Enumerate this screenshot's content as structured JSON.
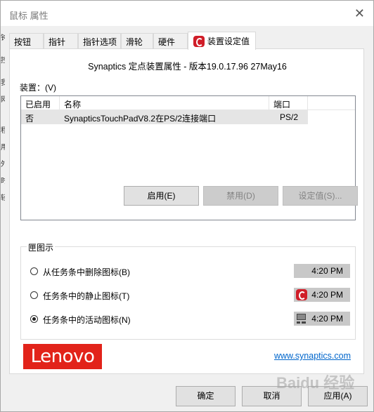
{
  "window": {
    "title": "鼠标 属性",
    "close_glyph": "✕"
  },
  "left_strip": [
    "钟",
    "控",
    "我",
    "网",
    "程",
    "用",
    "外",
    "时",
    "轻"
  ],
  "tabs": [
    {
      "label": "按钮"
    },
    {
      "label": "指针"
    },
    {
      "label": "指针选项"
    },
    {
      "label": "滑轮"
    },
    {
      "label": "硬件"
    },
    {
      "label": "装置设定值",
      "active": true,
      "icon": "synaptics-logo-icon"
    }
  ],
  "panel": {
    "heading": "Synaptics 定点装置属性 - 版本19.0.17.96 27May16",
    "devices_label": "装置：(V)",
    "table": {
      "columns": [
        "已启用",
        "名称",
        "端口"
      ],
      "rows": [
        {
          "enabled": "否",
          "name": "SynapticsTouchPadV8.2在PS/2连接端口",
          "port": "PS/2"
        }
      ]
    },
    "buttons": {
      "enable": "启用(E)",
      "disable": "禁用(D)",
      "settings": "设定值(S)..."
    },
    "tray_group": {
      "label": "匣图示",
      "options": [
        {
          "label": "从任务条中删除图标(B)",
          "time": "4:20 PM",
          "icon": "",
          "checked": false
        },
        {
          "label": "任务条中的静止图标(T)",
          "time": "4:20 PM",
          "icon": "synaptics-logo-icon",
          "checked": false
        },
        {
          "label": "任务条中的活动图标(N)",
          "time": "4:20 PM",
          "icon": "touchpad-icon",
          "checked": true
        }
      ]
    },
    "brand_logo": "Lenovo",
    "link": "www.synaptics.com"
  },
  "footer": {
    "ok": "确定",
    "cancel": "取消",
    "apply": "应用(A)"
  },
  "watermark": "Baidu 经验",
  "colors": {
    "accent": "#0078d7",
    "lenovo_red": "#e2231a",
    "synaptics_red": "#d01d28",
    "link": "#0066cc"
  }
}
